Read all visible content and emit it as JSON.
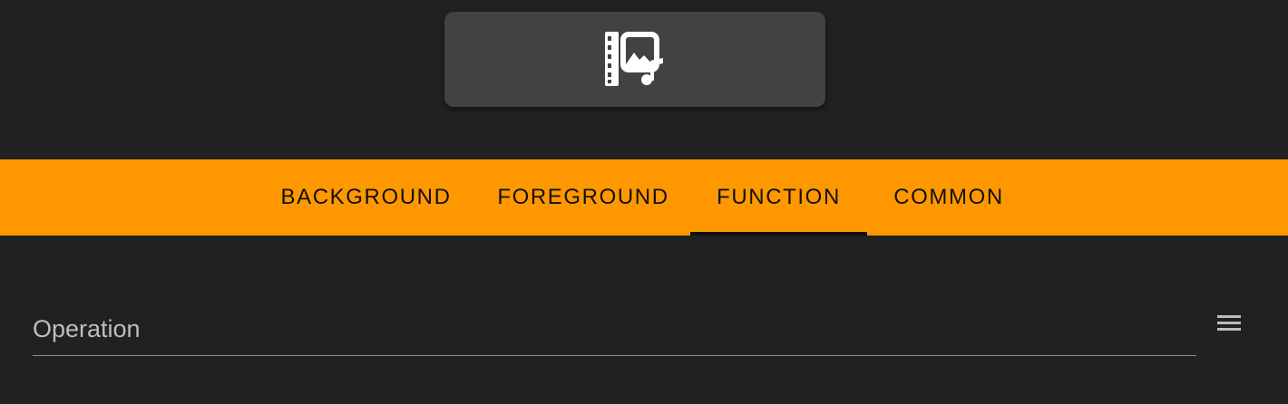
{
  "media_card": {
    "icon": "movie-image-music-icon"
  },
  "tabs": [
    {
      "label": "BACKGROUND",
      "active": false
    },
    {
      "label": "FOREGROUND",
      "active": false
    },
    {
      "label": "FUNCTION",
      "active": true
    },
    {
      "label": "COMMON",
      "active": false
    }
  ],
  "operation_field": {
    "label": "Operation"
  },
  "menu": {
    "icon": "hamburger-menu-icon"
  },
  "colors": {
    "background": "#212121",
    "card": "#424242",
    "accent": "#ff9800",
    "tab_text": "#111111",
    "field_label": "#bdbdbd",
    "icon": "#ffffff"
  }
}
